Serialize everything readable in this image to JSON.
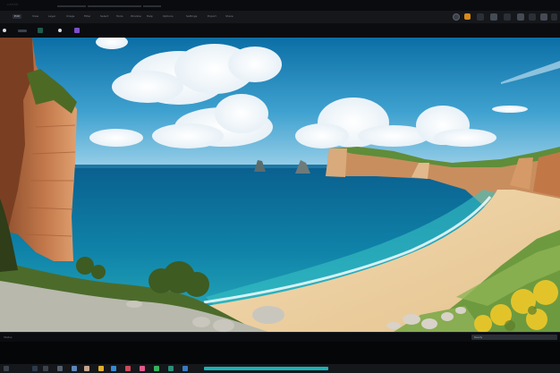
{
  "title_bar": {
    "text": "v.ᐸᐸᐸᐸ",
    "bars": [
      "",
      "",
      ""
    ]
  },
  "menu": {
    "items": [
      {
        "label": "Edit",
        "active": true
      },
      {
        "label": "View",
        "active": false
      },
      {
        "label": "Layer",
        "active": false
      },
      {
        "label": "Image",
        "active": false
      },
      {
        "label": "Filter",
        "active": false
      },
      {
        "label": "Select",
        "active": false
      },
      {
        "label": "Tools",
        "active": false
      },
      {
        "label": "Window",
        "active": false
      },
      {
        "label": "Help",
        "active": false
      },
      {
        "label": "Options",
        "active": false
      },
      {
        "label": "Settings",
        "active": false
      },
      {
        "label": "Export",
        "active": false
      },
      {
        "label": "Share",
        "active": false
      }
    ],
    "right_icons": [
      "circle-icon",
      "orange-icon",
      "panel-icon",
      "grid-icon",
      "window-icon",
      "cast-icon",
      "layout-icon",
      "split-icon",
      "min-icon",
      "close-icon"
    ]
  },
  "toolbar2": {
    "icons": [
      "stop-icon",
      "pen-icon",
      "camera-icon",
      "record-icon",
      "brush-icon"
    ]
  },
  "status": {
    "left_text": "Status",
    "right_text": "Ready"
  },
  "taskbar": {
    "icons": [
      "start-icon",
      "search-icon",
      "task-icon",
      "file-icon",
      "mail-icon",
      "store-icon",
      "edge-icon",
      "chrome-icon",
      "game-icon",
      "photo-icon",
      "music-icon",
      "video-icon",
      "settings-icon"
    ],
    "progress": 1.0
  },
  "colors": {
    "accent": "#18b3b7",
    "orange": "#d7891d",
    "purple": "#7a4fc9"
  }
}
